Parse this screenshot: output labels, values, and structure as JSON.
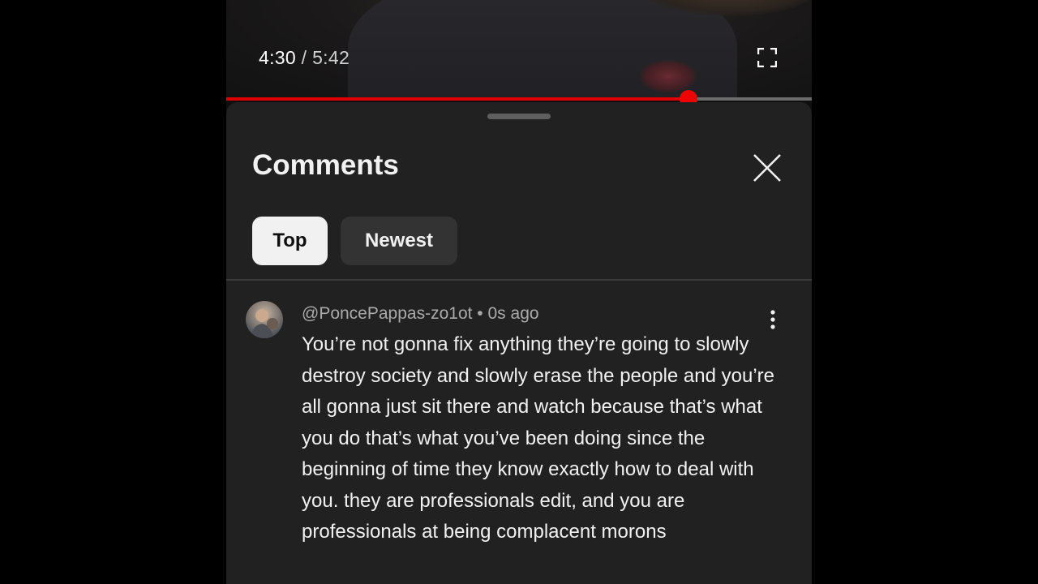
{
  "player": {
    "current_time": "4:30",
    "separator": "/",
    "duration": "5:42",
    "progress_fraction": 0.789,
    "colors": {
      "progress": "#e00000",
      "track": "#6b6b6b"
    },
    "fullscreen_icon": "fullscreen-icon"
  },
  "comments_panel": {
    "title": "Comments",
    "close_icon": "close-icon",
    "sort_chips": [
      {
        "label": "Top",
        "active": true
      },
      {
        "label": "Newest",
        "active": false
      }
    ],
    "comments": [
      {
        "author": "@PoncePappas-zo1ot",
        "dot": "•",
        "time_ago": "0s ago",
        "text": "You’re not gonna fix anything they’re going to slowly destroy society and slowly erase the people and you’re all gonna just sit there and watch because that’s what you do that’s what you’ve been doing since the beginning of time they know exactly how to deal with you. they are professionals edit, and you are professionals at being complacent morons",
        "menu_icon": "more-vert-icon"
      }
    ]
  }
}
